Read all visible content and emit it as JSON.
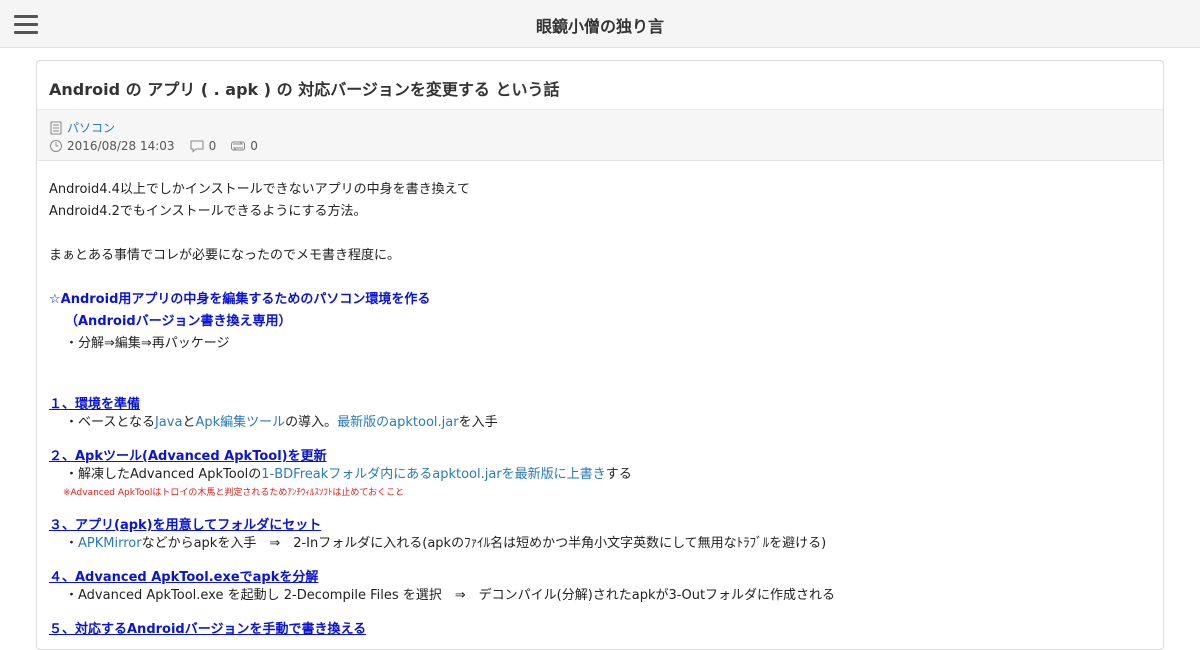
{
  "header": {
    "site_title": "眼鏡小僧の独り言",
    "menu_icon": "hamburger-menu-icon"
  },
  "post": {
    "title": "Android の アプリ ( . apk ) の 対応バージョンを変更する という話",
    "category": "パソコン",
    "date": "2016/08/28 14:03",
    "comments": "0",
    "trackbacks": "0",
    "icons": {
      "category": "document-icon",
      "date": "clock-icon",
      "comments": "comment-icon",
      "trackbacks": "trackback-icon"
    }
  },
  "content": {
    "intro1": "Android4.4以上でしかインストールできないアプリの中身を書き換えて",
    "intro2": "Android4.2でもインストールできるようにする方法。",
    "intro3": "まぁとある事情でコレが必要になったのでメモ書き程度に。",
    "section_title1": "☆Android用アプリの中身を編集するためのパソコン環境を作る",
    "section_title2": "（Androidバージョン書き換え専用）",
    "section_note": "・分解⇒編集⇒再パッケージ",
    "step1": {
      "heading": "１、環境を準備",
      "t1": "・ベースとなる",
      "link1": "Java",
      "t2": "と",
      "link2": "Apk編集ツール",
      "t3": "の導入。",
      "link3": "最新版のapktool.jar",
      "t4": "を入手"
    },
    "step2": {
      "heading": "２、Apkツール(Advanced ApkTool)を更新",
      "t1": "・解凍したAdvanced ApkToolの",
      "link1": "1-BDFreakフォルダ内にあるapktool.jarを最新版に上書き",
      "t2": "する",
      "warning": "※Advanced ApkToolはトロイの木馬と判定されるためｱﾝﾁｳｨﾙｽｿﾌﾄは止めておくこと"
    },
    "step3": {
      "heading": "３、アプリ(apk)を用意してフォルダにセット",
      "t1": "・",
      "link1": "APKMirror",
      "t2": "などからapkを入手　⇒　2-Inフォルダに入れる(apkのﾌｧｲﾙ名は短めかつ半角小文字英数にして無用なﾄﾗﾌﾞﾙを避ける)"
    },
    "step4": {
      "heading": "４、Advanced ApkTool.exeでapkを分解",
      "t1": "・Advanced ApkTool.exe を起動し 2-Decompile Files を選択　⇒　デコンパイル(分解)されたapkが3-Outフォルダに作成される"
    },
    "step5": {
      "heading": "５、対応するAndroidバージョンを手動で書き換える"
    }
  }
}
